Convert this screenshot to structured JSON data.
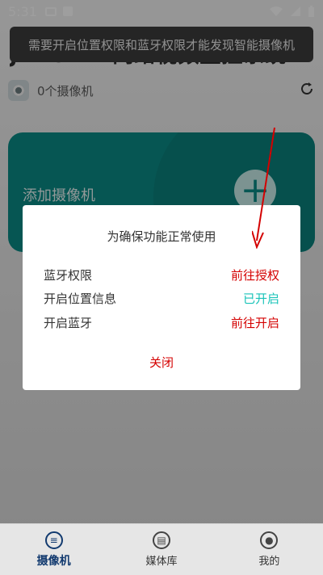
{
  "status_bar": {
    "time": "5:31"
  },
  "header": {
    "title": "JXLCAM 网络视频监控系统"
  },
  "toast": {
    "message": "需要开启位置权限和蓝牙权限才能发现智能摄像机"
  },
  "camera_list": {
    "count_label": "0个摄像机"
  },
  "add_card": {
    "label": "添加摄像机"
  },
  "dialog": {
    "title": "为确保功能正常使用",
    "rows": [
      {
        "name": "蓝牙权限",
        "action": "前往授权",
        "status_color": "#d40000"
      },
      {
        "name": "开启位置信息",
        "action": "已开启",
        "status_color": "#18c3b8"
      },
      {
        "name": "开启蓝牙",
        "action": "前往开启",
        "status_color": "#d40000"
      }
    ],
    "close_label": "关闭"
  },
  "bottom_nav": {
    "items": [
      {
        "label": "摄像机",
        "icon": "list-icon",
        "active": true
      },
      {
        "label": "媒体库",
        "icon": "folder-icon",
        "active": false
      },
      {
        "label": "我的",
        "icon": "user-icon",
        "active": false
      }
    ]
  },
  "colors": {
    "accent_teal": "#0b8b86",
    "danger_red": "#d40000",
    "success_teal": "#18c3b8",
    "nav_active": "#123a6f"
  }
}
